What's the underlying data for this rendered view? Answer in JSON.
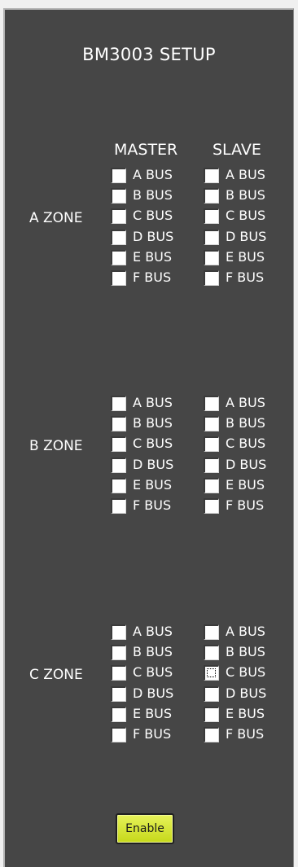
{
  "title": "BM3003 SETUP",
  "columns": {
    "master": "MASTER",
    "slave": "SLAVE"
  },
  "zones": [
    {
      "label": "A ZONE",
      "master": [
        {
          "label": "A BUS",
          "checked": false
        },
        {
          "label": "B BUS",
          "checked": false
        },
        {
          "label": "C BUS",
          "checked": false
        },
        {
          "label": "D BUS",
          "checked": false
        },
        {
          "label": "E BUS",
          "checked": false
        },
        {
          "label": "F BUS",
          "checked": false
        }
      ],
      "slave": [
        {
          "label": "A BUS",
          "checked": false
        },
        {
          "label": "B BUS",
          "checked": false
        },
        {
          "label": "C BUS",
          "checked": false
        },
        {
          "label": "D BUS",
          "checked": false
        },
        {
          "label": "E BUS",
          "checked": false
        },
        {
          "label": "F BUS",
          "checked": false
        }
      ]
    },
    {
      "label": "B ZONE",
      "master": [
        {
          "label": "A BUS",
          "checked": false
        },
        {
          "label": "B BUS",
          "checked": false
        },
        {
          "label": "C BUS",
          "checked": false
        },
        {
          "label": "D BUS",
          "checked": false
        },
        {
          "label": "E BUS",
          "checked": false
        },
        {
          "label": "F BUS",
          "checked": false
        }
      ],
      "slave": [
        {
          "label": "A BUS",
          "checked": false
        },
        {
          "label": "B BUS",
          "checked": false
        },
        {
          "label": "C BUS",
          "checked": false
        },
        {
          "label": "D BUS",
          "checked": false
        },
        {
          "label": "E BUS",
          "checked": false
        },
        {
          "label": "F BUS",
          "checked": false
        }
      ]
    },
    {
      "label": "C ZONE",
      "master": [
        {
          "label": "A BUS",
          "checked": false
        },
        {
          "label": "B BUS",
          "checked": false
        },
        {
          "label": "C BUS",
          "checked": false
        },
        {
          "label": "D BUS",
          "checked": false
        },
        {
          "label": "E BUS",
          "checked": false
        },
        {
          "label": "F BUS",
          "checked": false
        }
      ],
      "slave": [
        {
          "label": "A BUS",
          "checked": false
        },
        {
          "label": "B BUS",
          "checked": false
        },
        {
          "label": "C BUS",
          "checked": false,
          "focused": true
        },
        {
          "label": "D BUS",
          "checked": false
        },
        {
          "label": "E BUS",
          "checked": false
        },
        {
          "label": "F BUS",
          "checked": false
        }
      ]
    }
  ],
  "enable_button": {
    "label": "Enable"
  },
  "colors": {
    "panel_bg": "#464646",
    "text": "#ffffff",
    "button_bg": "#d4e42c"
  }
}
